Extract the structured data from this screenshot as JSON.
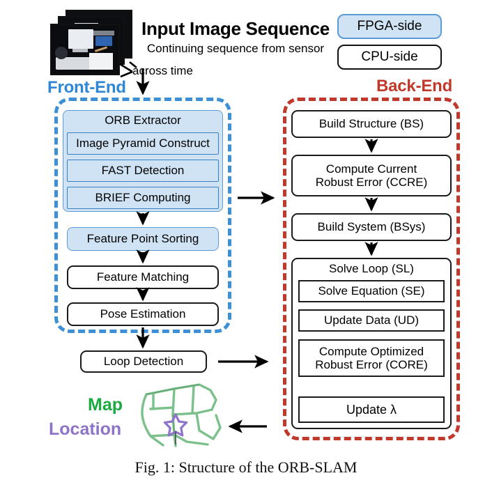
{
  "header": {
    "title": "Input Image Sequence",
    "subtitle": "Continuing sequence from sensor",
    "axis_note": "across time"
  },
  "legend": {
    "fpga": "FPGA-side",
    "cpu": "CPU-side",
    "fpga_fill": "#cfe3f5",
    "fpga_border": "#5b9bd5",
    "cpu_fill": "#ffffff",
    "cpu_border": "#111111"
  },
  "front_end": {
    "title": "Front-End",
    "color": "#2e86d6",
    "orb_group": {
      "label": "ORB Extractor",
      "children": [
        {
          "label": "Image Pyramid Construct"
        },
        {
          "label": "FAST Detection"
        },
        {
          "label": "BRIEF Computing"
        }
      ]
    },
    "steps": [
      {
        "label": "Feature Point Sorting",
        "side": "fpga"
      },
      {
        "label": "Feature Matching",
        "side": "cpu"
      },
      {
        "label": "Pose Estimation",
        "side": "cpu"
      }
    ]
  },
  "back_end": {
    "title": "Back-End",
    "color": "#c0392b",
    "steps": [
      {
        "label": "Build Structure (BS)"
      },
      {
        "label": "Compute Current\nRobust Error (CCRE)"
      },
      {
        "label": "Build System (BSys)"
      }
    ],
    "solve_loop": {
      "label": "Solve Loop (SL)",
      "children": [
        {
          "label": "Solve Equation (SE)"
        },
        {
          "label": "Update Data (UD)"
        },
        {
          "label": "Compute Optimized\nRobust Error (CORE)"
        },
        {
          "label": "Update λ"
        }
      ]
    }
  },
  "loop_detection": {
    "label": "Loop Detection"
  },
  "map": {
    "map_label": "Map",
    "location_label": "Location",
    "map_color": "#1aaa3f",
    "location_color": "#8e74c8",
    "marker": "star-marker"
  },
  "caption": "Fig. 1: Structure of the ORB-SLAM"
}
